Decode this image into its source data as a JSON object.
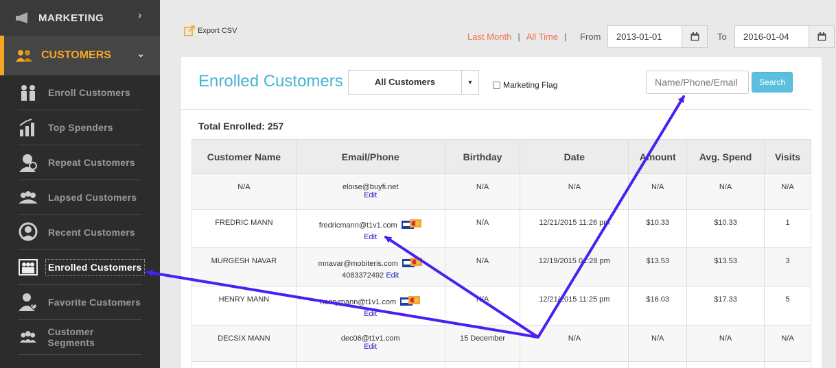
{
  "sidebar": {
    "marketing_label": "MARKETING",
    "customers_label": "CUSTOMERS",
    "items": [
      {
        "label": "Enroll Customers",
        "icon": "enroll-icon"
      },
      {
        "label": "Top Spenders",
        "icon": "top-spenders-icon"
      },
      {
        "label": "Repeat Customers",
        "icon": "repeat-customers-icon"
      },
      {
        "label": "Lapsed Customers",
        "icon": "lapsed-customers-icon"
      },
      {
        "label": "Recent Customers",
        "icon": "recent-customers-icon"
      },
      {
        "label": "Enrolled Customers",
        "icon": "enrolled-customers-icon"
      },
      {
        "label": "Favorite Customers",
        "icon": "favorite-customers-icon"
      },
      {
        "label": "Customer Segments",
        "icon": "customer-segments-icon"
      }
    ]
  },
  "topbar": {
    "export_label": "Export CSV",
    "last_month": "Last Month",
    "sep": "|",
    "all_time": "All Time",
    "from_label": "From",
    "from_value": "2013-01-01",
    "to_label": "To",
    "to_value": "2016-01-04"
  },
  "panel": {
    "title": "Enrolled Customers",
    "filter_value": "All Customers",
    "marketing_flag_label": "Marketing Flag",
    "search_placeholder": "Name/Phone/Email",
    "search_label": "Search",
    "total_enrolled": "Total Enrolled: 257"
  },
  "table": {
    "headers": [
      "Customer Name",
      "Email/Phone",
      "Birthday",
      "Date",
      "Amount",
      "Avg. Spend",
      "Visits"
    ],
    "rows": [
      {
        "name": "N/A",
        "email": "eloise@buyfi.net",
        "phone": "",
        "cards": false,
        "edit": "Edit",
        "birthday": "N/A",
        "date": "N/A",
        "amount": "N/A",
        "avg": "N/A",
        "visits": "N/A"
      },
      {
        "name": "FREDRIC MANN",
        "email": "fredricmann@t1v1.com",
        "phone": "",
        "cards": true,
        "edit": "Edit",
        "birthday": "N/A",
        "date": "12/21/2015 11:26 pm",
        "amount": "$10.33",
        "avg": "$10.33",
        "visits": "1"
      },
      {
        "name": "MURGESH NAVAR",
        "email": "mnavar@mobiteris.com",
        "phone": "4083372492",
        "cards": true,
        "edit": "Edit",
        "birthday": "N/A",
        "date": "12/19/2015 01:28 pm",
        "amount": "$13.53",
        "avg": "$13.53",
        "visits": "3"
      },
      {
        "name": "HENRY MANN",
        "email": "henrymann@t1v1.com",
        "phone": "",
        "cards": true,
        "edit": "Edit",
        "birthday": "N/A",
        "date": "12/21/2015 11:25 pm",
        "amount": "$16.03",
        "avg": "$17.33",
        "visits": "5"
      },
      {
        "name": "DECSIX MANN",
        "email": "dec06@t1v1.com",
        "phone": "",
        "cards": false,
        "edit": "Edit",
        "birthday": "15 December",
        "date": "N/A",
        "amount": "N/A",
        "avg": "N/A",
        "visits": "N/A"
      }
    ]
  },
  "colors": {
    "accent": "#f5a623",
    "title": "#4ab3d6",
    "link": "#f06e4f",
    "arrow": "#4a1ff0"
  }
}
